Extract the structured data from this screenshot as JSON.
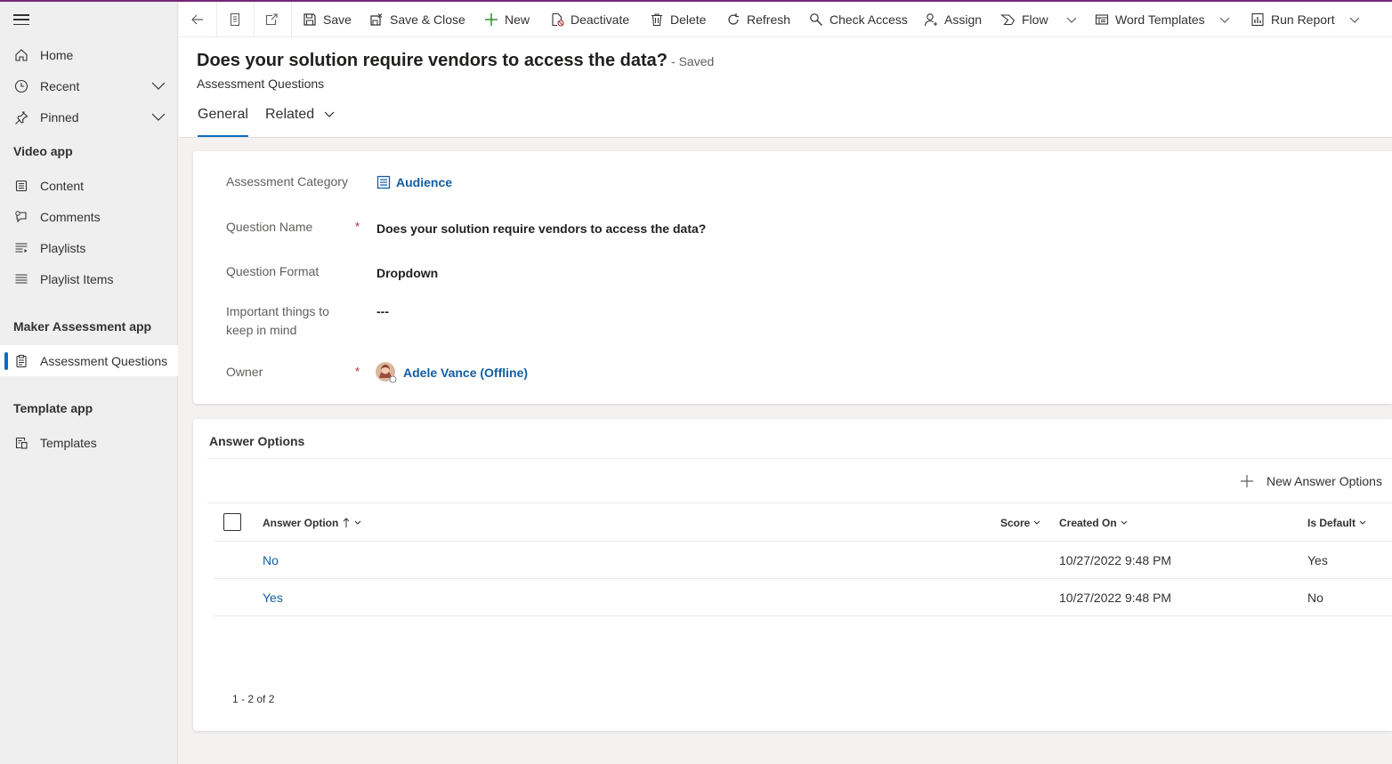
{
  "sidebar": {
    "items": [
      {
        "label": "Home"
      },
      {
        "label": "Recent"
      },
      {
        "label": "Pinned"
      }
    ],
    "groups": [
      {
        "title": "Video app",
        "items": [
          {
            "label": "Content"
          },
          {
            "label": "Comments"
          },
          {
            "label": "Playlists"
          },
          {
            "label": "Playlist Items"
          }
        ]
      },
      {
        "title": "Maker Assessment app",
        "items": [
          {
            "label": "Assessment Questions"
          }
        ]
      },
      {
        "title": "Template app",
        "items": [
          {
            "label": "Templates"
          }
        ]
      }
    ]
  },
  "toolbar": {
    "save": "Save",
    "save_close": "Save & Close",
    "new": "New",
    "deactivate": "Deactivate",
    "delete": "Delete",
    "refresh": "Refresh",
    "check_access": "Check Access",
    "assign": "Assign",
    "flow": "Flow",
    "word_templates": "Word Templates",
    "run_report": "Run Report"
  },
  "header": {
    "title": "Does your solution require vendors to access the data?",
    "status": "- Saved",
    "entity": "Assessment Questions",
    "tabs": [
      {
        "label": "General"
      },
      {
        "label": "Related"
      }
    ]
  },
  "form": {
    "category_label": "Assessment Category",
    "category_value": "Audience",
    "question_name_label": "Question Name",
    "question_name_value": "Does your solution require vendors to access the data?",
    "format_label": "Question Format",
    "format_value": "Dropdown",
    "important_label_1": "Important things to",
    "important_label_2": "keep in mind",
    "important_value": "---",
    "owner_label": "Owner",
    "owner_value": "Adele Vance (Offline)",
    "required_mark": "*"
  },
  "answers": {
    "title": "Answer Options",
    "new_button": "New Answer Options",
    "columns": {
      "answer_option": "Answer Option",
      "score": "Score",
      "created_on": "Created On",
      "is_default": "Is Default"
    },
    "rows": [
      {
        "answer_option": "No",
        "score": "",
        "created_on": "10/27/2022 9:48 PM",
        "is_default": "Yes"
      },
      {
        "answer_option": "Yes",
        "score": "",
        "created_on": "10/27/2022 9:48 PM",
        "is_default": "No"
      }
    ],
    "pager": "1 - 2 of 2"
  },
  "colors": {
    "accent": "#0f6cbd",
    "brand_topline": "#742774",
    "link": "#115ea3",
    "required": "#a4262c"
  }
}
